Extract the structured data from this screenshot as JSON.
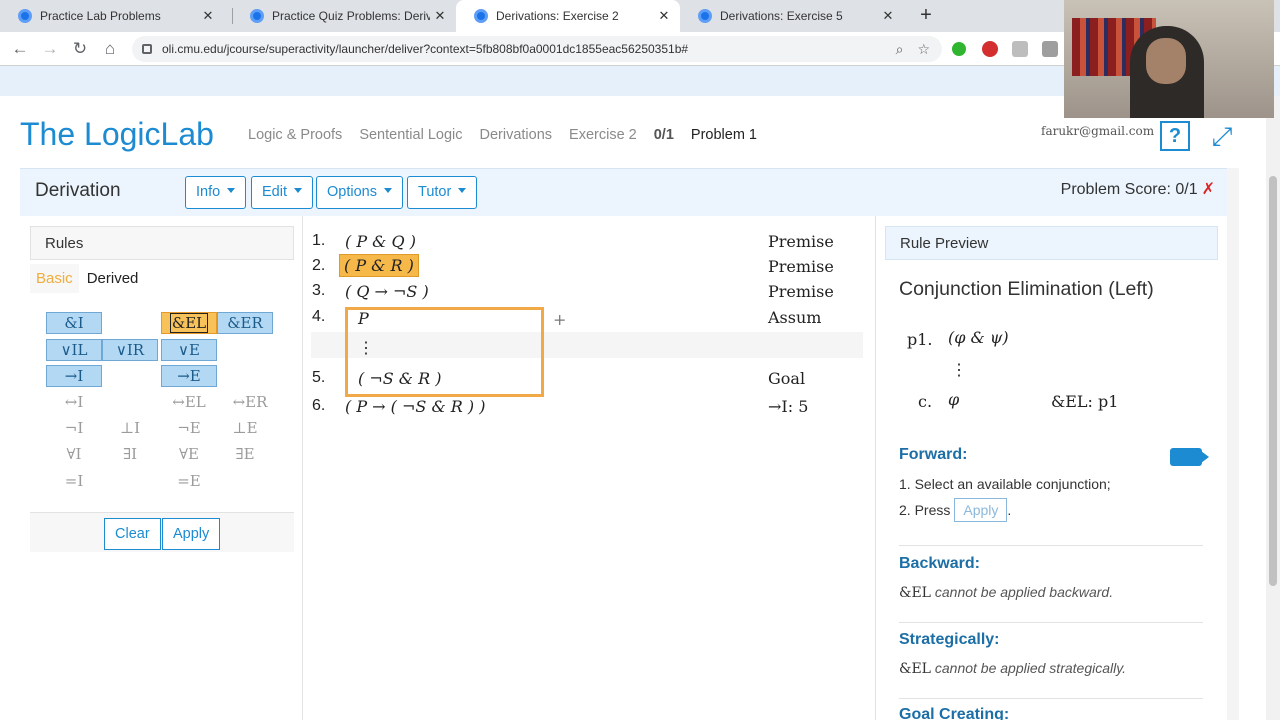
{
  "browser": {
    "tabs": [
      {
        "title": "Practice Lab Problems",
        "active": false
      },
      {
        "title": "Practice Quiz Problems: Derivatio",
        "active": false
      },
      {
        "title": "Derivations: Exercise 2",
        "active": true
      },
      {
        "title": "Derivations: Exercise 5",
        "active": false
      }
    ],
    "tab_close": "✕",
    "new_tab": "+",
    "url": "oli.cmu.edu/jcourse/superactivity/launcher/deliver?context=5fb808bf0a0001dc1855eac56250351b#"
  },
  "header": {
    "logo": "The LogicLab",
    "breadcrumbs": [
      "Logic & Proofs",
      "Sentential Logic",
      "Derivations",
      "Exercise 2"
    ],
    "score": "0/1",
    "current": "Problem 1",
    "email": "farukr@gmail.com",
    "help": "?",
    "expand_icon": "⤢"
  },
  "derivation_bar": {
    "title": "Derivation",
    "menus": [
      "Info",
      "Edit",
      "Options",
      "Tutor"
    ],
    "problem_score_label": "Problem Score: 0/1",
    "fail_mark": "✗"
  },
  "rules": {
    "title": "Rules",
    "tabs": [
      "Basic",
      "Derived"
    ],
    "active_tab": "Basic",
    "buttons": [
      {
        "label": "&I",
        "state": "on"
      },
      {
        "label": "&EL",
        "state": "sel"
      },
      {
        "label": "&ER",
        "state": "on"
      },
      {
        "label": "∨IL",
        "state": "on"
      },
      {
        "label": "∨IR",
        "state": "on"
      },
      {
        "label": "∨E",
        "state": "on"
      },
      {
        "label": "→I",
        "state": "on"
      },
      {
        "label": "→E",
        "state": "on"
      },
      {
        "label": "↔I",
        "state": "off"
      },
      {
        "label": "↔EL",
        "state": "off"
      },
      {
        "label": "↔ER",
        "state": "off"
      },
      {
        "label": "¬I",
        "state": "off"
      },
      {
        "label": "⊥I",
        "state": "off"
      },
      {
        "label": "¬E",
        "state": "off"
      },
      {
        "label": "⊥E",
        "state": "off"
      },
      {
        "label": "∀I",
        "state": "off"
      },
      {
        "label": "∃I",
        "state": "off"
      },
      {
        "label": "∀E",
        "state": "off"
      },
      {
        "label": "∃E",
        "state": "off"
      },
      {
        "label": "=I",
        "state": "off"
      },
      {
        "label": "=E",
        "state": "off"
      }
    ],
    "clear": "Clear",
    "apply": "Apply"
  },
  "derivation": {
    "lines": [
      {
        "num": "1.",
        "formula": "( P & Q )",
        "just": "Premise",
        "highlighted": false
      },
      {
        "num": "2.",
        "formula": "( P & R )",
        "just": "Premise",
        "highlighted": true
      },
      {
        "num": "3.",
        "formula": "( Q → ¬S )",
        "just": "Premise",
        "highlighted": false
      },
      {
        "num": "4.",
        "formula": "P",
        "just": "Assum",
        "highlighted": false
      },
      {
        "num": "",
        "formula": "⋮",
        "just": "",
        "highlighted": false
      },
      {
        "num": "5.",
        "formula": "( ¬S & R )",
        "just": "Goal",
        "highlighted": false
      },
      {
        "num": "6.",
        "formula": "( P → ( ¬S & R ) )",
        "just": "→I: 5",
        "highlighted": false
      }
    ],
    "add_symbol": "+"
  },
  "preview": {
    "header": "Rule Preview",
    "title": "Conjunction Elimination (Left)",
    "schema": [
      {
        "label": "p1.",
        "formula": "(φ & ψ)",
        "just": ""
      },
      {
        "label": "",
        "formula": "⋮",
        "just": ""
      },
      {
        "label": "c.",
        "formula": "φ",
        "just": "&EL: p1"
      }
    ],
    "forward": {
      "heading": "Forward:",
      "step1": "1.  Select an available conjunction;",
      "step2_prefix": "2.  Press",
      "step2_button": "Apply",
      "step2_suffix": "."
    },
    "backward": {
      "heading": "Backward:",
      "rule": "&EL",
      "text": "cannot be applied backward."
    },
    "strategic": {
      "heading": "Strategically:",
      "rule": "&EL",
      "text": "cannot be applied strategically."
    },
    "goal": {
      "heading": "Goal Creating:"
    }
  }
}
